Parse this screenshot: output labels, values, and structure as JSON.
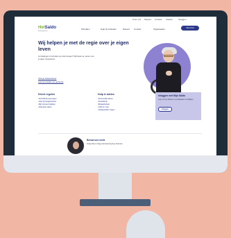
{
  "site": {
    "logo_part1": "Het",
    "logo_part2": "Saldo",
    "logo_sub": "Belastingdienst"
  },
  "utility": [
    "Over ons",
    "Nieuws",
    "Contact",
    "Zoeken",
    "Inloggen"
  ],
  "nav": {
    "items": [
      "Schulden",
      "Hulp bij schulden",
      "Nieuws",
      "Contact",
      "Organisaties"
    ],
    "cta": "Word lid"
  },
  "hero": {
    "title": "Wij helpen je met de regie over je eigen leven",
    "body": "Je betalingen of schulden op orde brengen? Wij helpen je, samen met je eigen zorgverlener.",
    "link1": "Vind je hulpverlener",
    "link2": "Hulp bij schulden per gemeente"
  },
  "col1": {
    "title": "Direct regelen",
    "items": [
      "Schuldhulp aanvragen",
      "Hulp bij budgetbeheer",
      "Mijn dossier bekijken",
      "Afspraak maken"
    ]
  },
  "col2": {
    "title": "Hulp & advies",
    "items": [
      "Persoonlijk advies",
      "Schuldhulp",
      "Budgetbeheer",
      "Geld en zorg",
      "Veelgestelde vragen"
    ]
  },
  "card": {
    "title": "Inloggen met Mijn Saldo",
    "body": "Log in om je dossier en je afspraken te bekijken.",
    "button": "Inloggen"
  },
  "bottom": {
    "title": "Benut uw recht",
    "body": "Vraag hulp en krijg ondersteuning bij je financiën."
  }
}
